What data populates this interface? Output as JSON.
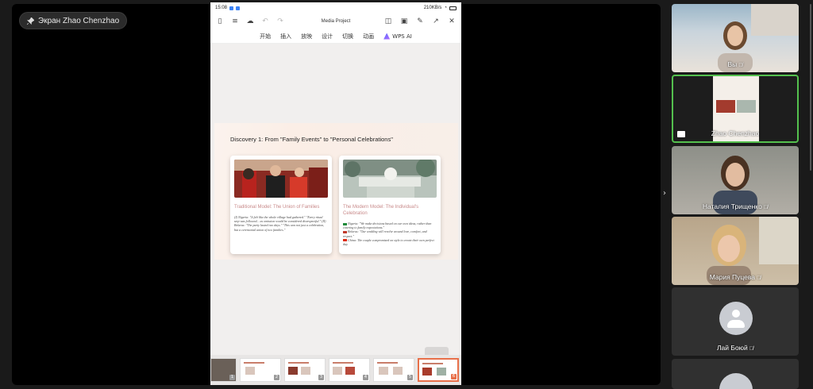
{
  "screen_share": {
    "pin_label": "Экран Zhao Chenzhao"
  },
  "tablet": {
    "status_time": "15:08",
    "status_right": "210KB/s",
    "doc_title": "Media Project",
    "menu": [
      "开始",
      "插入",
      "放映",
      "设计",
      "切换",
      "动画"
    ],
    "wps_ai": "WPS AI",
    "slide": {
      "title": "Discovery 1: From \"Family Events\" to \"Personal Celebrations\"",
      "left_card": {
        "heading": "Traditional Model: The Union of Families",
        "body": "(I) Nigeria: \"It felt like the whole village had gathered.\" \"Every ritual step was followed... as omission would be considered disrespectful.\" (II) Belarus: \"The party lasted two days.\" \"This was not just a celebration, but a ceremonial union of two families.\""
      },
      "right_card": {
        "heading": "The Modern Model: The Individual's Celebration",
        "body1": "Nigeria: \"We make decisions based on our own ideas, rather than catering to family expectations.\"",
        "body2": "Belarus: \"Our wedding will revolve around love, comfort, and respect.\"",
        "body3": "China: The couple compromised on style to create their own perfect day."
      }
    },
    "thumbnails": [
      "1",
      "2",
      "3",
      "4",
      "5",
      "6"
    ],
    "active_thumbnail": 6
  },
  "participants": [
    {
      "name": "Вы",
      "muted": true,
      "type": "video"
    },
    {
      "name": "Zhao Chenzhao",
      "muted": false,
      "type": "screen",
      "active": true
    },
    {
      "name": "Наталия Трищенко",
      "muted": true,
      "type": "video"
    },
    {
      "name": "Мария Пуцева",
      "muted": true,
      "type": "video"
    },
    {
      "name": "Лай Боюй",
      "muted": true,
      "type": "avatar"
    }
  ],
  "colors": {
    "active_border": "#54c04e",
    "slide_accent": "#c88a8a",
    "thumb_active": "#e8704a"
  }
}
